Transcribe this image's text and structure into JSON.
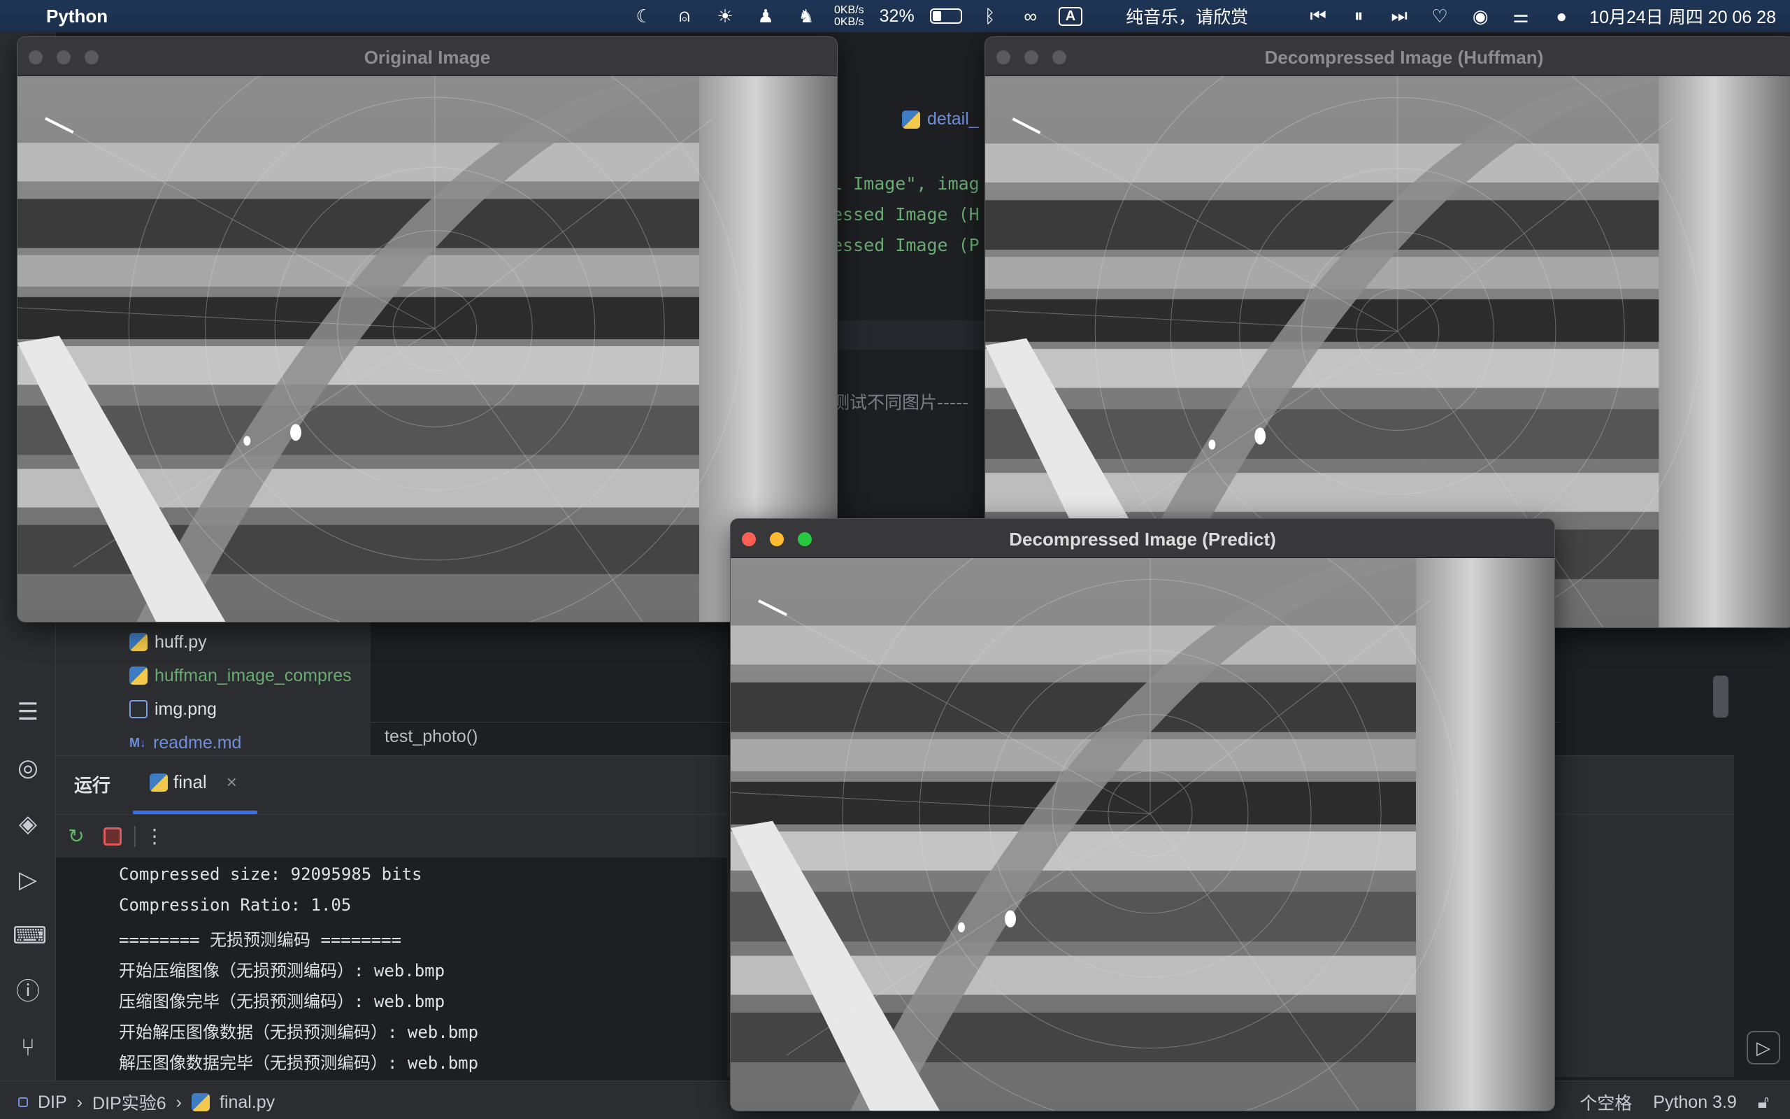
{
  "menubar": {
    "app_name": "Python",
    "net_up": "0KB/s",
    "net_down": "0KB/s",
    "battery_percent": "32%",
    "battery_level": 0.32,
    "input_method": "A",
    "now_playing": "纯音乐，请欣赏",
    "clock": "10月24日 周四 20 06 28"
  },
  "windows": {
    "original": {
      "title": "Original Image"
    },
    "huffman": {
      "title": "Decompressed Image (Huffman)"
    },
    "predict": {
      "title": "Decompressed Image (Predict)"
    }
  },
  "editor": {
    "tab_label": "detail_",
    "lines": [
      "l Image\", imag",
      "essed Image (H",
      "essed Image (P"
    ],
    "comment": "测试不同图片-----",
    "call": "test_photo()"
  },
  "filetree": {
    "items": [
      "huff.py",
      "huffman_image_compres",
      "img.png",
      "readme.md"
    ]
  },
  "runpanel": {
    "title": "运行",
    "tab": "final",
    "console": [
      "Compressed size: 92095985 bits",
      "Compression Ratio: 1.05",
      "======== 无损预测编码 ========",
      "开始压缩图像（无损预测编码）: web.bmp",
      "压缩图像完毕（无损预测编码）: web.bmp",
      "开始解压图像数据（无损预测编码）: web.bmp",
      "解压图像数据完毕（无损预测编码）: web.bmp"
    ]
  },
  "statusbar": {
    "breadcrumb": [
      "DIP",
      "DIP实验6",
      "final.py"
    ],
    "indent": "个空格",
    "interpreter": "Python 3.9"
  }
}
